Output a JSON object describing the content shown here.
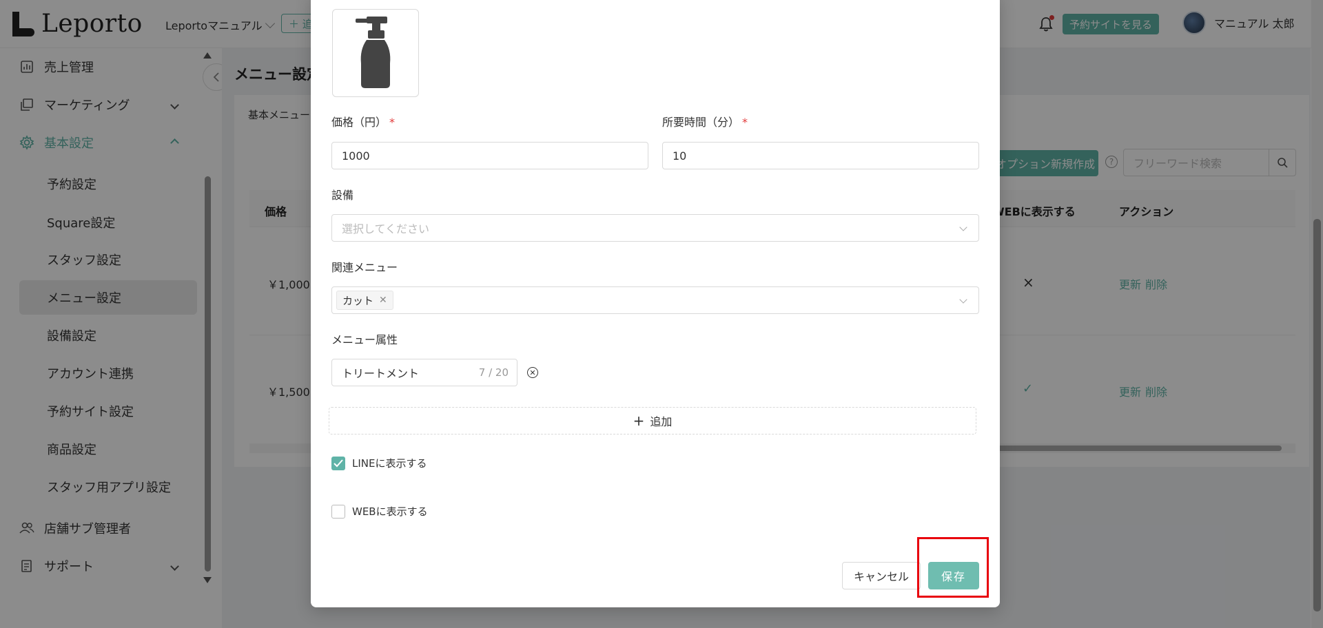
{
  "header": {
    "logo_text": "Leporto",
    "store_name": "Leportoマニュアル",
    "add_store_label": "＋ 追",
    "site_button": "予約サイトを見る",
    "user_name": "マニュアル 太郎"
  },
  "sidebar": {
    "items": [
      {
        "label": "売上管理"
      },
      {
        "label": "マーケティング"
      },
      {
        "label": "基本設定"
      },
      {
        "label": "店舗サブ管理者"
      },
      {
        "label": "サポート"
      }
    ],
    "sub_items": [
      {
        "label": "予約設定"
      },
      {
        "label": "Square設定"
      },
      {
        "label": "スタッフ設定"
      },
      {
        "label": "メニュー設定"
      },
      {
        "label": "設備設定"
      },
      {
        "label": "アカウント連携"
      },
      {
        "label": "予約サイト設定"
      },
      {
        "label": "商品設定"
      },
      {
        "label": "スタッフ用アプリ設定"
      }
    ]
  },
  "main": {
    "page_title": "メニュー設定",
    "tab_label": "基本メニュー",
    "option_button": "オプション新規作成",
    "search_placeholder": "フリーワード検索",
    "table": {
      "headers": {
        "price": "価格",
        "web": "WEBに表示する",
        "action": "アクション"
      },
      "rows": [
        {
          "price": "￥1,000",
          "web": "×",
          "update": "更新",
          "delete": "削除"
        },
        {
          "price": "￥1,500",
          "web": "✓",
          "update": "更新",
          "delete": "削除"
        }
      ]
    }
  },
  "modal": {
    "price_label": "価格（円）",
    "price_value": "1000",
    "duration_label": "所要時間（分）",
    "duration_value": "10",
    "equipment_label": "設備",
    "equipment_placeholder": "選択してください",
    "related_label": "関連メニュー",
    "related_tag": "カット",
    "attribute_label": "メニュー属性",
    "attribute_value": "トリートメント",
    "attribute_counter": "7 / 20",
    "add_label": "追加",
    "line_label": "LINEに表示する",
    "line_checked": true,
    "web_label": "WEBに表示する",
    "web_checked": false,
    "cancel_label": "キャンセル",
    "save_label": "保存"
  },
  "colors": {
    "accent": "#5fb3a7",
    "required": "#e23b3b",
    "highlight": "#e8000c"
  }
}
